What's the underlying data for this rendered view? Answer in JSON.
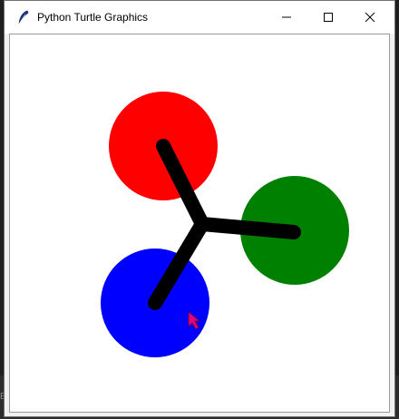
{
  "window": {
    "title": "Python Turtle Graphics",
    "icon": "feather-icon",
    "controls": [
      "minimize-icon",
      "maximize-icon",
      "close-icon"
    ]
  },
  "background_window": {
    "text_fragment": "ER"
  },
  "canvas": {
    "background": "#ffffff",
    "circles": [
      {
        "name": "red-circle",
        "color": "#ff0000"
      },
      {
        "name": "green-circle",
        "color": "#008000"
      },
      {
        "name": "blue-circle",
        "color": "#0000ff"
      }
    ],
    "lines_color": "#000000",
    "cursor_color": "#e6007e"
  }
}
